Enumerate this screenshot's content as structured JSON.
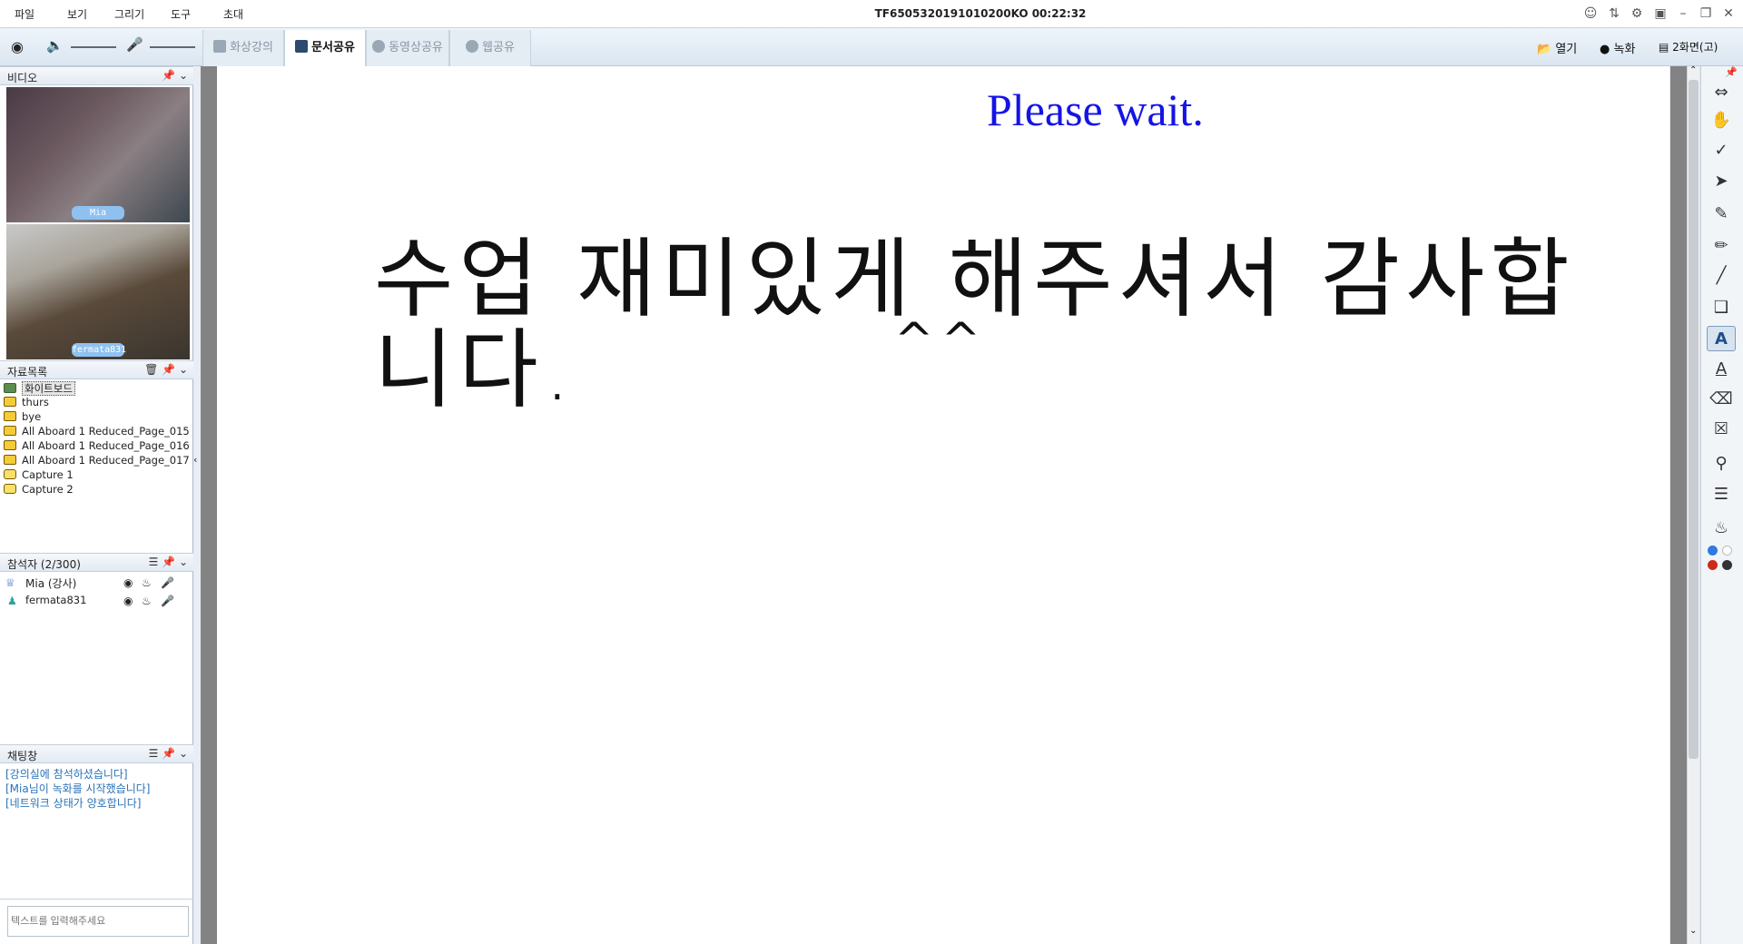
{
  "menu": [
    "파일",
    "보기",
    "그리기",
    "도구",
    "초대"
  ],
  "window_title": "TF6505320191010200KO 00:22:32",
  "tabs": [
    {
      "label": "화상강의",
      "active": false
    },
    {
      "label": "문서공유",
      "active": true
    },
    {
      "label": "동영상공유",
      "active": false
    },
    {
      "label": "웹공유",
      "active": false
    }
  ],
  "toolbar_right": {
    "open": "열기",
    "record": "녹화",
    "screen": "2화면(고)"
  },
  "video_panel": {
    "title": "비디오",
    "participants": [
      "Mia",
      "fermata831"
    ]
  },
  "doc_panel": {
    "title": "자료목록",
    "items": [
      {
        "label": "화이트보드",
        "kind": "whiteboard"
      },
      {
        "label": "thurs",
        "kind": "doc"
      },
      {
        "label": "bye",
        "kind": "doc"
      },
      {
        "label": "All Aboard 1 Reduced_Page_015",
        "kind": "doc"
      },
      {
        "label": "All Aboard 1 Reduced_Page_016",
        "kind": "doc"
      },
      {
        "label": "All Aboard 1 Reduced_Page_017",
        "kind": "doc"
      },
      {
        "label": "Capture 1",
        "kind": "capture"
      },
      {
        "label": "Capture 2",
        "kind": "capture"
      }
    ]
  },
  "participants_panel": {
    "title": "참석자 (2/300)",
    "rows": [
      {
        "name": "Mia (강사)",
        "role": "host"
      },
      {
        "name": "fermata831",
        "role": "student"
      }
    ]
  },
  "chat_panel": {
    "title": "채팅창",
    "messages": [
      "[강의실에 참석하셨습니다]",
      "[Mia님이 녹화를 시작했습니다]",
      "[네트워크 상태가 양호합니다]"
    ],
    "input_placeholder": "텍스트를 입력해주세요"
  },
  "whiteboard": {
    "header_text": "Please wait.",
    "handwritten_text": "수업 재미있게 해주셔서 감사합니다.",
    "caret_text": "^^"
  },
  "colors": {
    "accent_blue": "#1414e6",
    "chat_blue": "#2a72b8",
    "toolbar_bg": "#dfe8f1"
  },
  "right_tools": [
    "fit-width-icon",
    "hand-icon",
    "check-icon",
    "pointer-icon",
    "pen-icon",
    "highlighter-icon",
    "line-icon",
    "shape-icon",
    "text-icon",
    "text-box-icon",
    "eraser-icon",
    "clear-eraser-icon",
    "zoom-icon",
    "line-weight-icon",
    "palette-icon"
  ]
}
